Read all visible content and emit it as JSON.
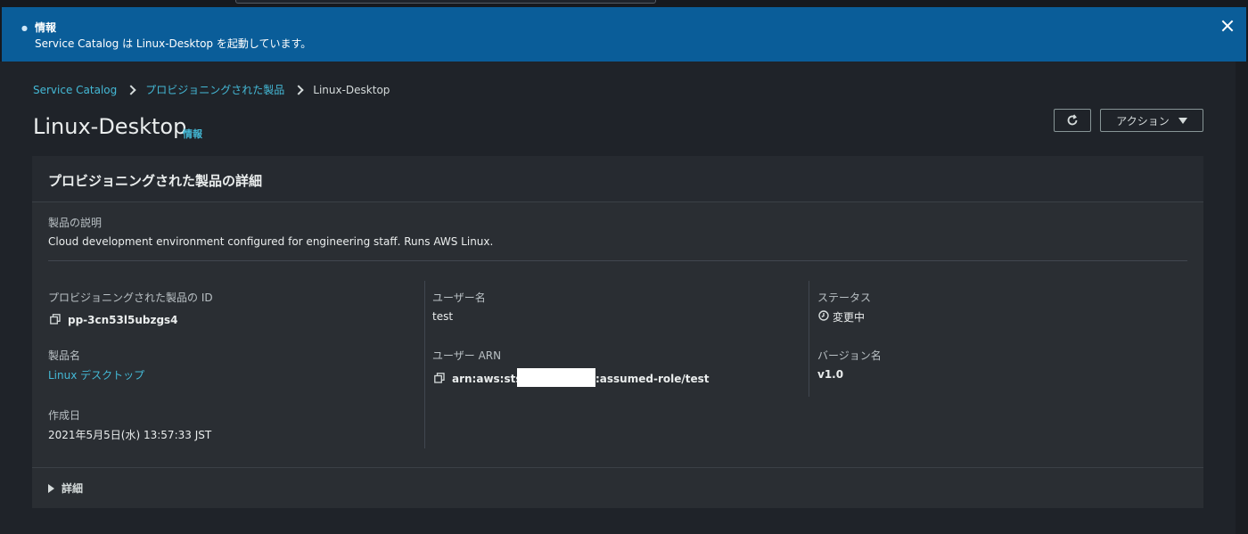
{
  "flash": {
    "title": "情報",
    "message": "Service Catalog は Linux-Desktop を起動しています。"
  },
  "breadcrumb": {
    "root": "Service Catalog",
    "parent": "プロビジョニングされた製品",
    "current": "Linux-Desktop"
  },
  "page": {
    "title": "Linux-Desktop",
    "info_link": "情報"
  },
  "toolbar": {
    "actions_label": "アクション"
  },
  "panel": {
    "header": "プロビジョニングされた製品の詳細",
    "description_label": "製品の説明",
    "description_value": "Cloud development environment configured for engineering staff. Runs AWS Linux.",
    "provisioned_id_label": "プロビジョニングされた製品の ID",
    "provisioned_id_value": "pp-3cn53l5ubzgs4",
    "product_name_label": "製品名",
    "product_name_value": "Linux デスクトップ",
    "created_label": "作成日",
    "created_value": "2021年5月5日(水) 13:57:33 JST",
    "username_label": "ユーザー名",
    "username_value": "test",
    "user_arn_label": "ユーザー ARN",
    "user_arn_prefix": "arn:aws:sts::",
    "user_arn_suffix": ":assumed-role/test",
    "status_label": "ステータス",
    "status_value": "変更中",
    "version_label": "バージョン名",
    "version_value": "v1.0",
    "details_expander": "詳細"
  },
  "colors": {
    "flash_bg": "#0a5d99",
    "link": "#44b9d6",
    "page_bg": "#1f2329",
    "panel_bg": "#2a2e33"
  },
  "icons": {
    "refresh": "refresh-icon",
    "copy": "copy-icon",
    "status": "clock-icon",
    "close": "close-icon"
  }
}
